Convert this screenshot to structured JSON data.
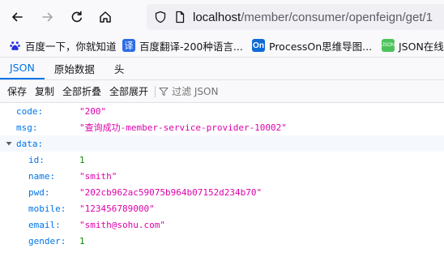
{
  "browser": {
    "url_host": "localhost",
    "url_path": "/member/consumer/openfeign/get/1"
  },
  "bookmarks": [
    {
      "label": "百度一下，你就知道",
      "icon": "baidu-paw-icon"
    },
    {
      "label": "百度翻译-200种语言...",
      "icon": "baidu-translate-icon",
      "glyph": "译"
    },
    {
      "label": "ProcessOn思维导图...",
      "icon": "processon-icon",
      "glyph": "On"
    },
    {
      "label": "JSON在线解",
      "icon": "json-online-icon",
      "glyph": "JSON"
    }
  ],
  "viewer": {
    "tabs": [
      {
        "label": "JSON",
        "active": true
      },
      {
        "label": "原始数据",
        "active": false
      },
      {
        "label": "头",
        "active": false
      }
    ],
    "toolbar": {
      "save": "保存",
      "copy": "复制",
      "collapse_all": "全部折叠",
      "expand_all": "全部展开",
      "filter_placeholder": "过滤 JSON"
    }
  },
  "json": {
    "code_key": "code:",
    "code_val": "\"200\"",
    "msg_key": "msg:",
    "msg_val": "\"查询成功-member-service-provider-10002\"",
    "data_key": "data:",
    "fields": [
      {
        "key": "id:",
        "value": "1",
        "type": "number"
      },
      {
        "key": "name:",
        "value": "\"smith\"",
        "type": "string"
      },
      {
        "key": "pwd:",
        "value": "\"202cb962ac59075b964b07152d234b70\"",
        "type": "string"
      },
      {
        "key": "mobile:",
        "value": "\"123456789000\"",
        "type": "string"
      },
      {
        "key": "email:",
        "value": "\"smith@sohu.com\"",
        "type": "string"
      },
      {
        "key": "gender:",
        "value": "1",
        "type": "number"
      }
    ]
  },
  "colors": {
    "key": "#0074e8",
    "string": "#dd00a9",
    "number": "#058b00",
    "active_tab": "#0074e8"
  }
}
